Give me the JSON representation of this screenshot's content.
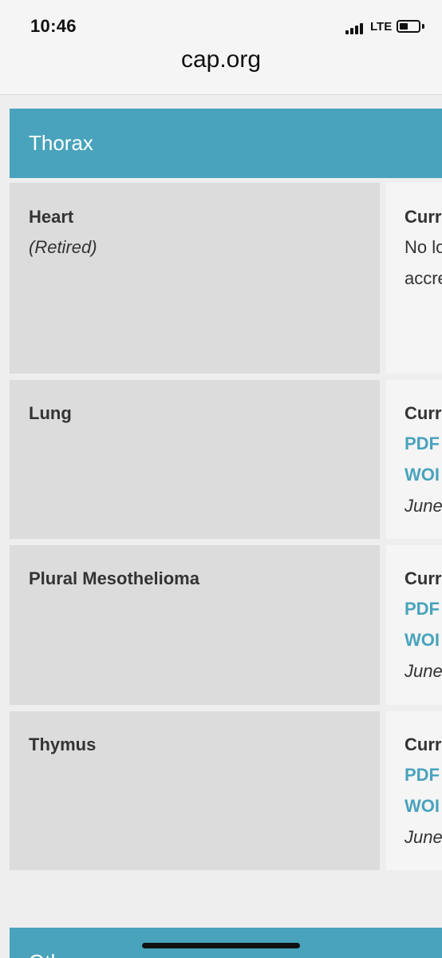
{
  "status_bar": {
    "time": "10:46",
    "network": "LTE",
    "battery_level": 0.45
  },
  "browser": {
    "url": "cap.org"
  },
  "sections": [
    {
      "title": "Thorax",
      "rows": [
        {
          "name": "Heart",
          "note": "(Retired)",
          "right_lines": [
            "Curr",
            "No lo",
            "accre"
          ]
        },
        {
          "name": "Lung",
          "right_lines": [
            "Curr",
            "PDF",
            "WOI",
            "June"
          ]
        },
        {
          "name": "Plural Mesothelioma",
          "right_lines": [
            "Curr",
            "PDF",
            "WOI",
            "June"
          ]
        },
        {
          "name": "Thymus",
          "right_lines": [
            "Curr",
            "PDF",
            "WOI",
            "June"
          ]
        }
      ]
    },
    {
      "title": "Other"
    }
  ]
}
